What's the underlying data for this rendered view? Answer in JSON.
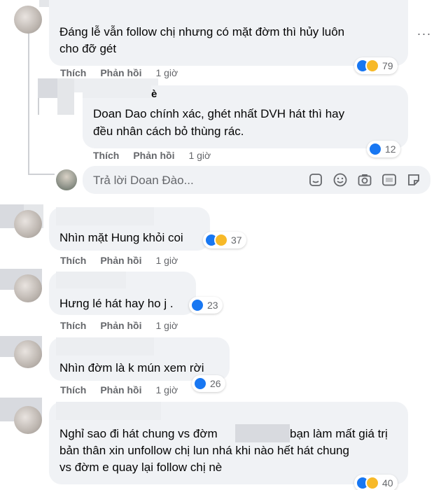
{
  "actions": {
    "like": "Thích",
    "reply": "Phản hồi"
  },
  "comments": [
    {
      "lines": [
        "Đáng lễ vẫn follow chị nhưng có mặt đờm thì hủy luôn",
        "cho đỡ gét"
      ],
      "time": "1 giờ",
      "reactions": [
        "like",
        "haha"
      ],
      "reaction_count": "79"
    },
    {
      "author_partial": "è",
      "lines": [
        "Doan Dao chính xác, ghét nhất DVH hát thì hay",
        "đều nhân cách bỏ thùng rác."
      ],
      "time": "1 giờ",
      "reactions": [
        "like"
      ],
      "reaction_count": "12"
    },
    {
      "lines": [
        "Nhìn mặt Hung khỏi coi"
      ],
      "time": "1 giờ",
      "reactions": [
        "like",
        "haha"
      ],
      "reaction_count": "37"
    },
    {
      "lines": [
        "Hưng lé hát hay ho j ."
      ],
      "time": "1 giờ",
      "reactions": [
        "like"
      ],
      "reaction_count": "23"
    },
    {
      "lines": [
        "Nhìn đờm là k mún xem rời"
      ],
      "time": "1 giờ",
      "reactions": [
        "like"
      ],
      "reaction_count": "26"
    },
    {
      "lines": [
        "Nghỉ sao đi hát chung vs đờm",
        "bạn làm mất giá trị",
        "bản thân xin unfollow chị lun nhá khi nào hết hát chung",
        "vs đờm e quay lại follow chị nè"
      ],
      "reactions": [
        "like",
        "haha"
      ],
      "reaction_count": "40"
    }
  ],
  "reply_box": {
    "placeholder": "Trả lời Doan Đào..."
  },
  "more_button": "···"
}
